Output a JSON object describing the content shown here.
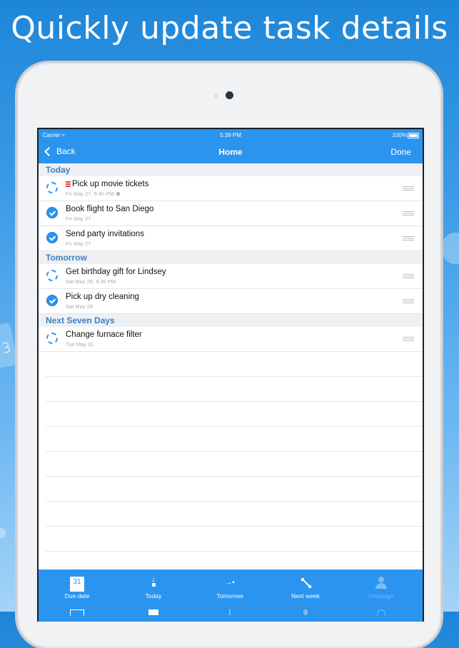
{
  "headline": "Quickly update task details",
  "status_bar": {
    "carrier": "Carrier",
    "time": "5:39 PM",
    "battery": "100%"
  },
  "nav": {
    "back_label": "Back",
    "title": "Home",
    "done_label": "Done"
  },
  "sections": [
    {
      "title": "Today",
      "tasks": [
        {
          "title": "Pick up movie tickets",
          "date": "Fri May 27, 6:40 PM",
          "done": false,
          "priority": true,
          "alarm": true
        },
        {
          "title": "Book flight to San Diego",
          "date": "Fri May 27",
          "done": true
        },
        {
          "title": "Send party invitations",
          "date": "Fri May 27",
          "done": true
        }
      ]
    },
    {
      "title": "Tomorrow",
      "tasks": [
        {
          "title": "Get birthday gift for Lindsey",
          "date": "Sat May 28, 4:30 PM",
          "done": false
        },
        {
          "title": "Pick up dry cleaning",
          "date": "Sat May 28",
          "done": true
        }
      ]
    },
    {
      "title": "Next Seven Days",
      "tasks": [
        {
          "title": "Change furnace filter",
          "date": "Tue May 31",
          "done": false
        }
      ]
    }
  ],
  "toolbar": {
    "due_date_label": "Due date",
    "due_date_icon_text": "31",
    "today_label": "Today",
    "tomorrow_label": "Tomorrow",
    "next_week_label": "Next week",
    "unassign_label": "Unassign"
  },
  "colors": {
    "accent": "#2b94ee",
    "section_text": "#3e7fc0",
    "priority": "#e0463c"
  }
}
